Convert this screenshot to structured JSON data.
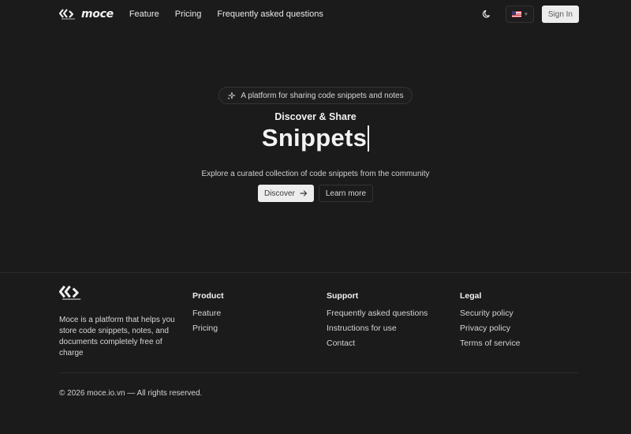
{
  "header": {
    "brand": "moce",
    "nav": [
      "Feature",
      "Pricing",
      "Frequently asked questions"
    ],
    "signin_label": "Sign In"
  },
  "hero": {
    "pill_text": "A platform for sharing code snippets and notes",
    "subtitle": "Discover & Share",
    "title": "Snippets",
    "description": "Explore a curated collection of code snippets from the community",
    "discover_label": "Discover",
    "learn_more_label": "Learn more"
  },
  "footer": {
    "description": "Moce is a platform that helps you store code snippets, notes, and documents completely free of charge",
    "columns": [
      {
        "heading": "Product",
        "links": [
          "Feature",
          "Pricing"
        ]
      },
      {
        "heading": "Support",
        "links": [
          "Frequently asked questions",
          "Instructions for use",
          "Contact"
        ]
      },
      {
        "heading": "Legal",
        "links": [
          "Security policy",
          "Privacy policy",
          "Terms of service"
        ]
      }
    ],
    "copyright": "© 2026 moce.io.vn — All rights reserved."
  },
  "icons": {
    "logo": "moce-logo-icon",
    "theme": "moon-icon",
    "flag": "us-flag-icon",
    "chevron": "chevron-down-icon",
    "sparkle": "sparkles-icon",
    "arrow": "arrow-right-icon"
  },
  "colors": {
    "background": "#1b1b1b",
    "text": "#e6e6e6",
    "button_light": "#ededed",
    "border": "#343434"
  }
}
